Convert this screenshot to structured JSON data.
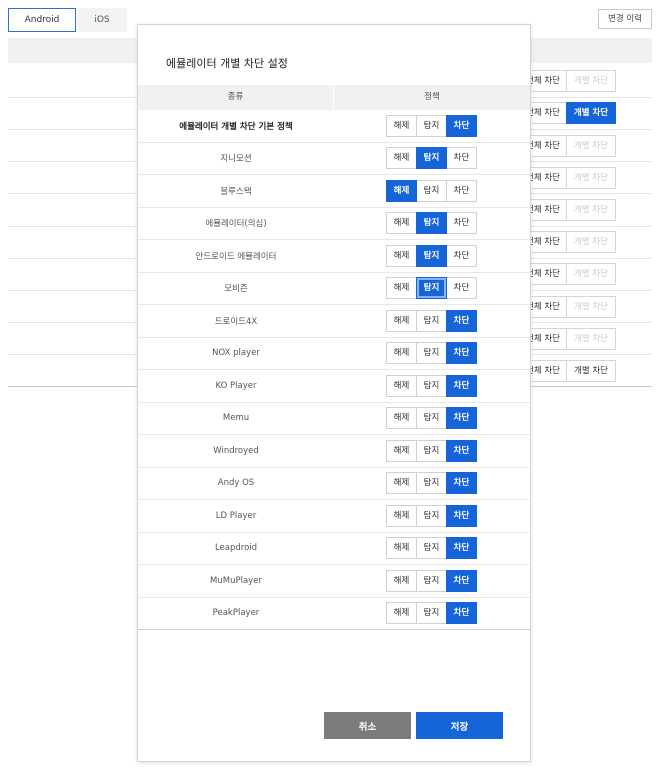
{
  "tabs": [
    {
      "label": "Android",
      "active": true
    },
    {
      "label": "iOS",
      "active": false
    }
  ],
  "history_button": "변경 이력",
  "background_rows": [
    {
      "all_label": "전체 차단",
      "indiv_label": "개별 차단",
      "indiv_state": "disabled"
    },
    {
      "all_label": "전체 차단",
      "indiv_label": "개별 차단",
      "indiv_state": "selected"
    },
    {
      "all_label": "전체 차단",
      "indiv_label": "개별 차단",
      "indiv_state": "disabled"
    },
    {
      "all_label": "전체 차단",
      "indiv_label": "개별 차단",
      "indiv_state": "disabled"
    },
    {
      "all_label": "전체 차단",
      "indiv_label": "개별 차단",
      "indiv_state": "disabled"
    },
    {
      "all_label": "전체 차단",
      "indiv_label": "개별 차단",
      "indiv_state": "disabled"
    },
    {
      "all_label": "전체 차단",
      "indiv_label": "개별 차단",
      "indiv_state": "disabled"
    },
    {
      "all_label": "전체 차단",
      "indiv_label": "개별 차단",
      "indiv_state": "disabled"
    },
    {
      "all_label": "전체 차단",
      "indiv_label": "개별 차단",
      "indiv_state": "disabled"
    },
    {
      "all_label": "전체 차단",
      "indiv_label": "개별 차단",
      "indiv_state": "normal"
    }
  ],
  "modal": {
    "title": "에뮬레이터 개별 차단 설정",
    "columns": {
      "type": "종류",
      "policy": "정책"
    },
    "options": [
      "해제",
      "탐지",
      "차단"
    ],
    "rows": [
      {
        "name": "에뮬레이터 개별 차단 기본 정책",
        "selected": 2,
        "bold": true
      },
      {
        "name": "지니모션",
        "selected": 1
      },
      {
        "name": "블루스택",
        "selected": 0
      },
      {
        "name": "에뮬레이터(의심)",
        "selected": 1
      },
      {
        "name": "안드로이드 에뮬레이터",
        "selected": 1
      },
      {
        "name": "모비즌",
        "selected": 1,
        "focused": true
      },
      {
        "name": "드로이드4X",
        "selected": 2
      },
      {
        "name": "NOX player",
        "selected": 2
      },
      {
        "name": "KO Player",
        "selected": 2
      },
      {
        "name": "Memu",
        "selected": 2
      },
      {
        "name": "Windroyed",
        "selected": 2
      },
      {
        "name": "Andy OS",
        "selected": 2
      },
      {
        "name": "LD Player",
        "selected": 2
      },
      {
        "name": "Leapdroid",
        "selected": 2
      },
      {
        "name": "MuMuPlayer",
        "selected": 2
      },
      {
        "name": "PeakPlayer",
        "selected": 2
      }
    ],
    "cancel_label": "취소",
    "save_label": "저장"
  },
  "colors": {
    "accent": "#1565d8",
    "cancel": "#7b7b7b"
  }
}
